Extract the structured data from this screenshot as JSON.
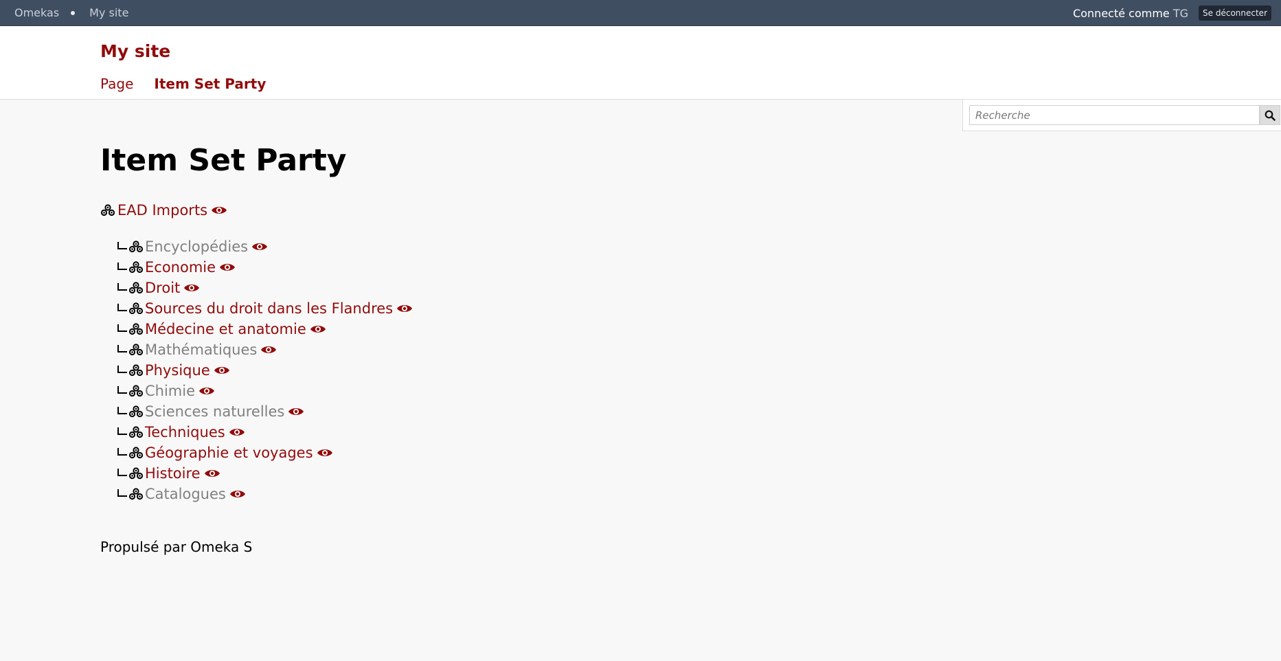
{
  "admin_bar": {
    "brand": "Omekas",
    "site_link": "My site",
    "logged_prefix": "Connecté comme",
    "user": "TG",
    "logout_label": "Se déconnecter"
  },
  "header": {
    "site_title": "My site",
    "nav": [
      {
        "label": "Page"
      },
      {
        "label": "Item Set Party"
      }
    ]
  },
  "search": {
    "placeholder": "Recherche",
    "button_icon": "search-icon"
  },
  "main": {
    "title": "Item Set Party",
    "root": {
      "label": "EAD Imports"
    },
    "children": [
      {
        "label": "Encyclopédies",
        "muted": true
      },
      {
        "label": "Economie",
        "muted": false
      },
      {
        "label": "Droit",
        "muted": false
      },
      {
        "label": "Sources du droit dans les Flandres",
        "muted": false
      },
      {
        "label": "Médecine et anatomie",
        "muted": false
      },
      {
        "label": "Mathématiques",
        "muted": true
      },
      {
        "label": "Physique",
        "muted": false
      },
      {
        "label": "Chimie",
        "muted": true
      },
      {
        "label": "Sciences naturelles",
        "muted": true
      },
      {
        "label": "Techniques",
        "muted": false
      },
      {
        "label": "Géographie et voyages",
        "muted": false
      },
      {
        "label": "Histoire",
        "muted": false
      },
      {
        "label": "Catalogues",
        "muted": true
      }
    ]
  },
  "footer": {
    "text": "Propulsé par Omeka S"
  },
  "colors": {
    "accent": "#920b0b",
    "muted": "#808080",
    "admin_bar": "#404e61"
  }
}
